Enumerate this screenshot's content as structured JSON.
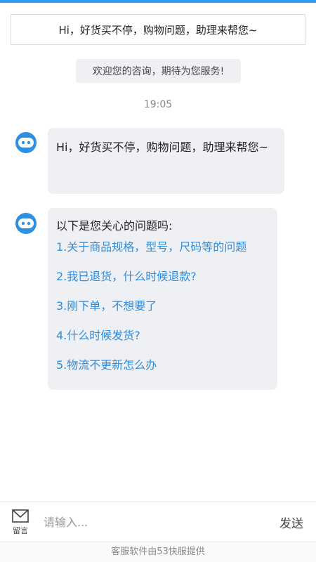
{
  "banner": {
    "text": "Hi，好货买不停，购物问题，助理来帮您~"
  },
  "welcome": {
    "text": "欢迎您的咨询，期待为您服务!"
  },
  "timestamp": "19:05",
  "messages": [
    {
      "sender_icon": "robot-avatar-icon",
      "text": "Hi，好货买不停，购物问题，助理来帮您~"
    },
    {
      "sender_icon": "robot-avatar-icon",
      "intro": "以下是您关心的问题吗:",
      "questions": [
        "1.关于商品规格，型号，尺码等的问题",
        "2.我已退货，什么时候退款?",
        "3.刚下单，不想要了",
        "4.什么时候发货?",
        "5.物流不更新怎么办"
      ]
    }
  ],
  "input_bar": {
    "message_icon": "envelope-icon",
    "message_label": "留言",
    "placeholder": "请输入...",
    "send_label": "发送"
  },
  "footer": {
    "text": "客服软件由53快服提供"
  },
  "colors": {
    "accent": "#2f9cf2",
    "link": "#2a8de0",
    "bubble_bg": "#eef0f4"
  }
}
